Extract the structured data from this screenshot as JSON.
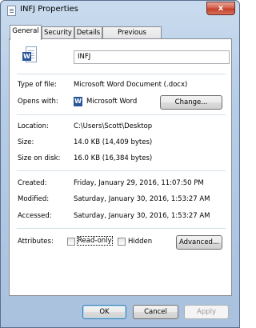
{
  "window": {
    "title": "INFJ Properties",
    "close_glyph": "x"
  },
  "tabs": [
    {
      "label": "General"
    },
    {
      "label": "Security"
    },
    {
      "label": "Details"
    },
    {
      "label": "Previous Versions"
    }
  ],
  "file": {
    "name": "INFJ",
    "icon": "word-document-icon"
  },
  "fields": {
    "type_label": "Type of file:",
    "type_value": "Microsoft Word Document (.docx)",
    "opens_label": "Opens with:",
    "opens_value": "Microsoft Word",
    "change_button": "Change...",
    "location_label": "Location:",
    "location_value": "C:\\Users\\Scott\\Desktop",
    "size_label": "Size:",
    "size_value": "14.0 KB (14,409 bytes)",
    "size_disk_label": "Size on disk:",
    "size_disk_value": "16.0 KB (16,384 bytes)",
    "created_label": "Created:",
    "created_value": "Friday, January 29, 2016, 11:07:50 PM",
    "modified_label": "Modified:",
    "modified_value": "Saturday, January 30, 2016, 1:53:27 AM",
    "accessed_label": "Accessed:",
    "accessed_value": "Saturday, January 30, 2016, 1:53:27 AM",
    "attributes_label": "Attributes:",
    "readonly_label": "Read-only",
    "hidden_label": "Hidden",
    "advanced_button": "Advanced..."
  },
  "attributes": {
    "read_only": false,
    "hidden": false
  },
  "buttons": {
    "ok": "OK",
    "cancel": "Cancel",
    "apply": "Apply"
  },
  "word_badge": "W"
}
